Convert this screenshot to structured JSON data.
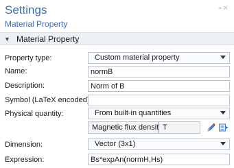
{
  "header": {
    "title": "Settings",
    "subtitle": "Material Property",
    "icons": [
      "pin-icon",
      "close-icon"
    ]
  },
  "section": {
    "title": "Material Property",
    "expanded": true
  },
  "form": {
    "property_type": {
      "label": "Property type:",
      "value": "Custom material property"
    },
    "name": {
      "label": "Name:",
      "value": "normB"
    },
    "description": {
      "label": "Description:",
      "value": "Norm of B"
    },
    "symbol": {
      "label": "Symbol (LaTeX encoded):",
      "value": ""
    },
    "physical_quantity": {
      "label": "Physical quantity:",
      "value": "From built-in quantities"
    },
    "quantity": {
      "name": "Magnetic flux density",
      "unit": "T"
    },
    "dimension": {
      "label": "Dimension:",
      "value": "Vector (3x1)"
    },
    "expression": {
      "label": "Expression:",
      "value": "Bs*expAn(normH,Hs)"
    }
  },
  "colors": {
    "accent": "#3d6fb6",
    "section_bg": "#eceff3"
  }
}
